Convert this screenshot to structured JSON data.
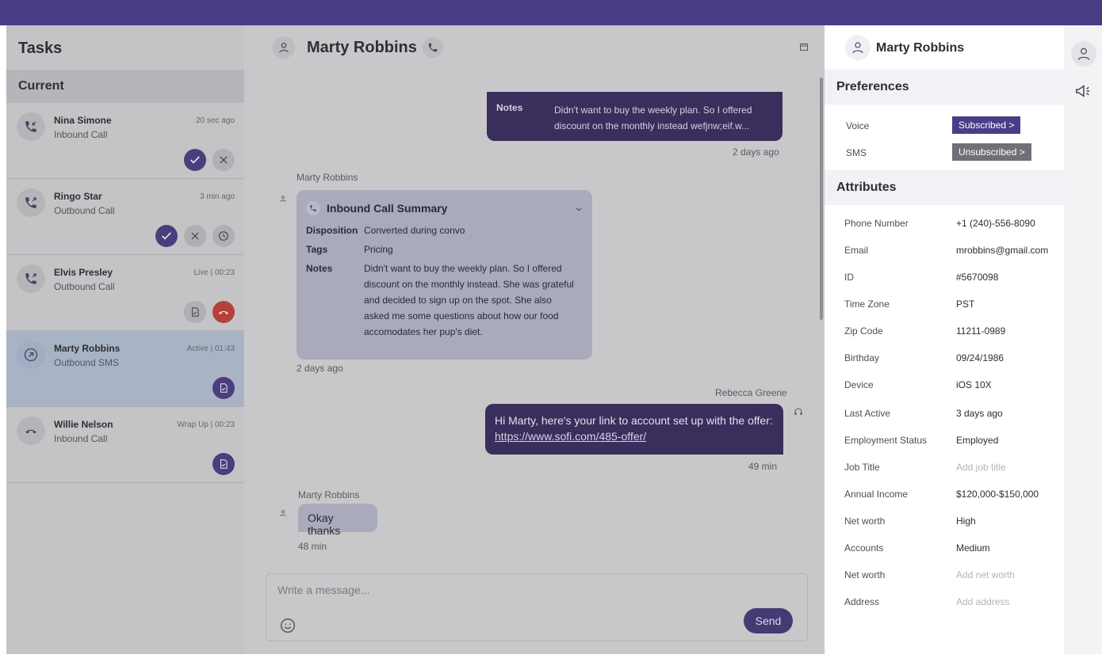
{
  "tasks": {
    "title": "Tasks",
    "section": "Current",
    "items": [
      {
        "name": "Nina Simone",
        "type": "Inbound Call",
        "time": "20 sec ago",
        "icon": "incoming-call-icon"
      },
      {
        "name": "Ringo Star",
        "type": "Outbound Call",
        "time": "3 min ago",
        "icon": "outgoing-call-icon"
      },
      {
        "name": "Elvis Presley",
        "type": "Outbound Call",
        "time": "Live | 00:23",
        "icon": "outgoing-call-icon"
      },
      {
        "name": "Marty Robbins",
        "type": "Outbound SMS",
        "time": "Active | 01:43",
        "icon": "sms-outgoing-icon"
      },
      {
        "name": "Willie Nelson",
        "type": "Inbound Call",
        "time": "Wrap Up | 00:23",
        "icon": "call-ended-icon"
      }
    ]
  },
  "chat": {
    "contact": "Marty Robbins",
    "top_message": {
      "notes_label": "Notes",
      "notes": "Didn't want to buy the weekly plan. So I offered discount on the monthly instead wefjnw;eif.w...",
      "time": "2 days ago"
    },
    "summary": {
      "sender": "Marty Robbins",
      "title": "Inbound Call Summary",
      "disposition_label": "Disposition",
      "disposition": "Converted during convo",
      "tags_label": "Tags",
      "tags": "Pricing",
      "notes_label": "Notes",
      "notes": "Didn't want to buy the weekly plan. So I offered discount on the monthly instead. She was grateful and decided to sign up on the spot. She also asked me some questions about how our food accomodates her pup's diet.",
      "time": "2 days ago"
    },
    "outgoing": {
      "sender": "Rebecca Greene",
      "text": "Hi Marty, here's your link to account set up with the offer:",
      "link": "https://www.sofi.com/485-offer/",
      "time": "49 min"
    },
    "incoming": {
      "sender": "Marty Robbins",
      "text": "Okay thanks",
      "time": "48 min"
    },
    "composer": {
      "placeholder": "Write a message...",
      "send_label": "Send"
    }
  },
  "profile": {
    "name": "Marty Robbins",
    "preferences_title": "Preferences",
    "preferences": [
      {
        "label": "Voice",
        "value": "Subscribed >",
        "status": "subscribed"
      },
      {
        "label": "SMS",
        "value": "Unsubscribed >",
        "status": "unsubscribed"
      }
    ],
    "attributes_title": "Attributes",
    "attributes": [
      {
        "label": "Phone Number",
        "value": "+1 (240)-556-8090",
        "placeholder": false
      },
      {
        "label": "Email",
        "value": "mrobbins@gmail.com",
        "placeholder": false
      },
      {
        "label": "ID",
        "value": "#5670098",
        "placeholder": false
      },
      {
        "label": "Time Zone",
        "value": "PST",
        "placeholder": false
      },
      {
        "label": "Zip Code",
        "value": "11211-0989",
        "placeholder": false
      },
      {
        "label": "Birthday",
        "value": "09/24/1986",
        "placeholder": false
      },
      {
        "label": "Device",
        "value": "iOS 10X",
        "placeholder": false
      },
      {
        "label": "Last Active",
        "value": "3 days ago",
        "placeholder": false
      },
      {
        "label": "Employment Status",
        "value": "Employed",
        "placeholder": false
      },
      {
        "label": "Job Title",
        "value": "Add job title",
        "placeholder": true
      },
      {
        "label": "Annual Income",
        "value": "$120,000-$150,000",
        "placeholder": false
      },
      {
        "label": "Net worth",
        "value": "High",
        "placeholder": false
      },
      {
        "label": "Accounts",
        "value": "Medium",
        "placeholder": false
      },
      {
        "label": "Net worth",
        "value": "Add net worth",
        "placeholder": true
      },
      {
        "label": "Address",
        "value": "Add address",
        "placeholder": true
      }
    ]
  },
  "colors": {
    "brand": "#4a3b85",
    "bubble_dark": "#3a2e5c",
    "end_call": "#b4413d"
  }
}
